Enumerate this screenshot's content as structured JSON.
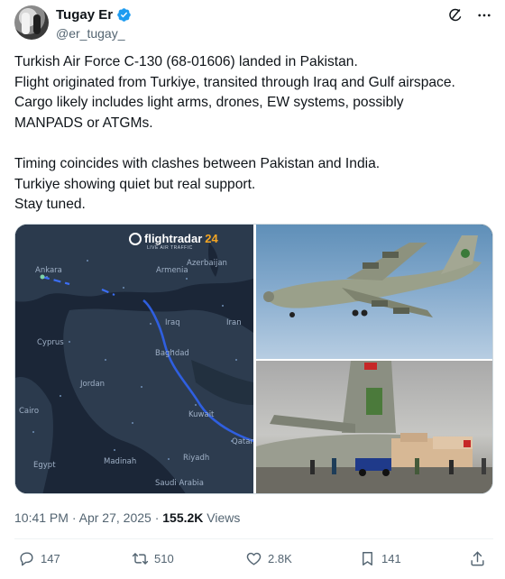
{
  "author": {
    "display_name": "Tugay Er",
    "handle": "@er_tugay_",
    "verified": true
  },
  "header_icons": [
    "grok-icon",
    "more-icon"
  ],
  "tweet": {
    "lines": [
      "Turkish Air Force C-130 (68-01606) landed in Pakistan.",
      "Flight originated from Turkiye, transited through Iraq and Gulf airspace.",
      "Cargo likely includes light arms, drones, EW systems, possibly",
      "MANPADS or ATGMs.",
      "",
      "Timing coincides with clashes between Pakistan and India.",
      "Turkiye showing quiet but real support.",
      "Stay tuned."
    ]
  },
  "media": {
    "map": {
      "logo_text": "flightradar",
      "logo_number": "24",
      "logo_sub": "LIVE AIR TRAFFIC",
      "labels": [
        "Ankara",
        "Armenia",
        "Azerbaijan",
        "Cyprus",
        "Baghdad",
        "Jordan",
        "Cairo",
        "Kuwait",
        "Madinah",
        "Riyadh",
        "Saudi Arabia",
        "Qatar",
        "Egypt",
        "Iran",
        "Iraq"
      ]
    },
    "photo_top_alt": "C-130 aircraft in flight",
    "photo_bottom_alt": "C-130 unloading cargo on tarmac"
  },
  "meta": {
    "time": "10:41 PM",
    "separator": "·",
    "date": "Apr 27, 2025",
    "views_count": "155.2K",
    "views_label": "Views"
  },
  "actions": {
    "replies": "147",
    "reposts": "510",
    "likes": "2.8K",
    "bookmarks": "141"
  },
  "colors": {
    "text": "#0f1419",
    "secondary": "#536471",
    "verified": "#1d9bf0",
    "border": "#cfd9de"
  }
}
